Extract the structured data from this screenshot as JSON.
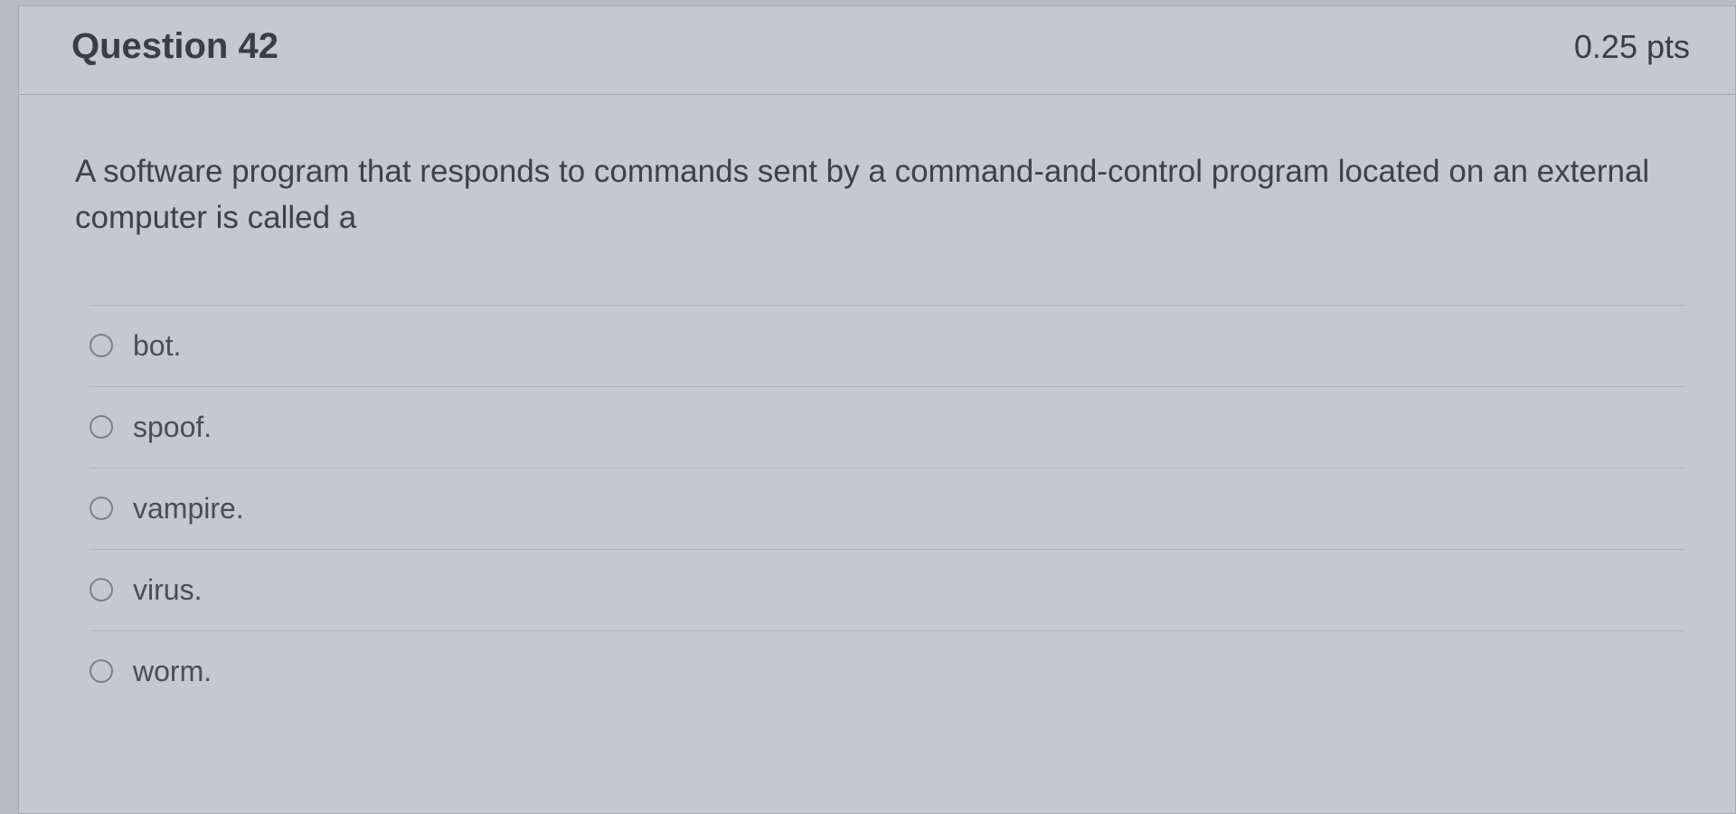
{
  "question": {
    "title": "Question 42",
    "points": "0.25 pts",
    "prompt": "A software program that responds to commands sent by a command-and-control program located on an external computer is called a",
    "options": [
      {
        "label": "bot."
      },
      {
        "label": "spoof."
      },
      {
        "label": "vampire."
      },
      {
        "label": "virus."
      },
      {
        "label": "worm."
      }
    ]
  }
}
